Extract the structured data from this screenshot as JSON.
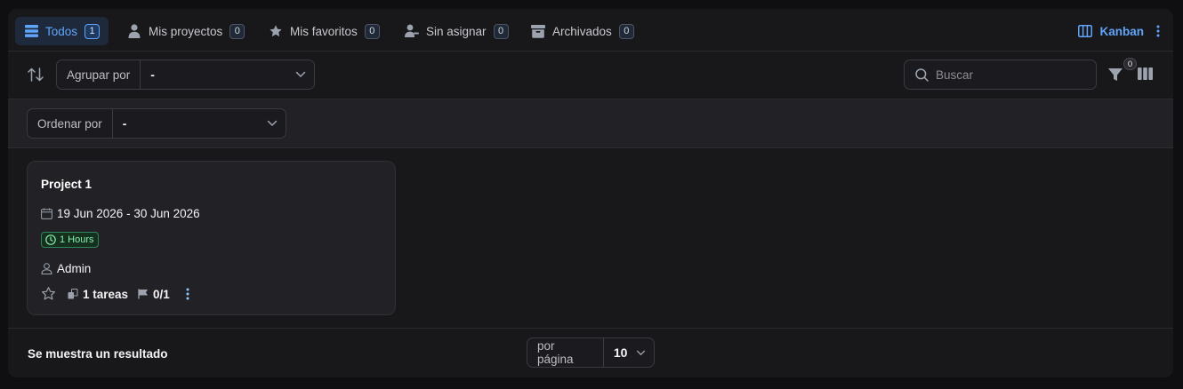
{
  "tabs": [
    {
      "label": "Todos",
      "count": "1",
      "icon": "list-icon"
    },
    {
      "label": "Mis proyectos",
      "count": "0",
      "icon": "user-icon"
    },
    {
      "label": "Mis favoritos",
      "count": "0",
      "icon": "star-icon"
    },
    {
      "label": "Sin asignar",
      "count": "0",
      "icon": "user-minus-icon"
    },
    {
      "label": "Archivados",
      "count": "0",
      "icon": "archive-icon"
    }
  ],
  "view": {
    "label": "Kanban",
    "icon": "columns-icon"
  },
  "toolbar": {
    "group_by_label": "Agrupar por",
    "group_by_value": "-",
    "search_placeholder": "Buscar",
    "filter_count": "0"
  },
  "sortrow": {
    "order_by_label": "Ordenar por",
    "order_by_value": "-"
  },
  "project": {
    "title": "Project 1",
    "dates": "19 Jun 2026 - 30 Jun 2026",
    "hours": "1 Hours",
    "assignee": "Admin",
    "tasks": "1 tareas",
    "milestones": "0/1"
  },
  "footer": {
    "result_text": "Se muestra un resultado",
    "per_page_label": "por página",
    "per_page_value": "10"
  },
  "colors": {
    "accent": "#60a5fa",
    "background": "#18181b",
    "hours_badge": "#86efac"
  }
}
